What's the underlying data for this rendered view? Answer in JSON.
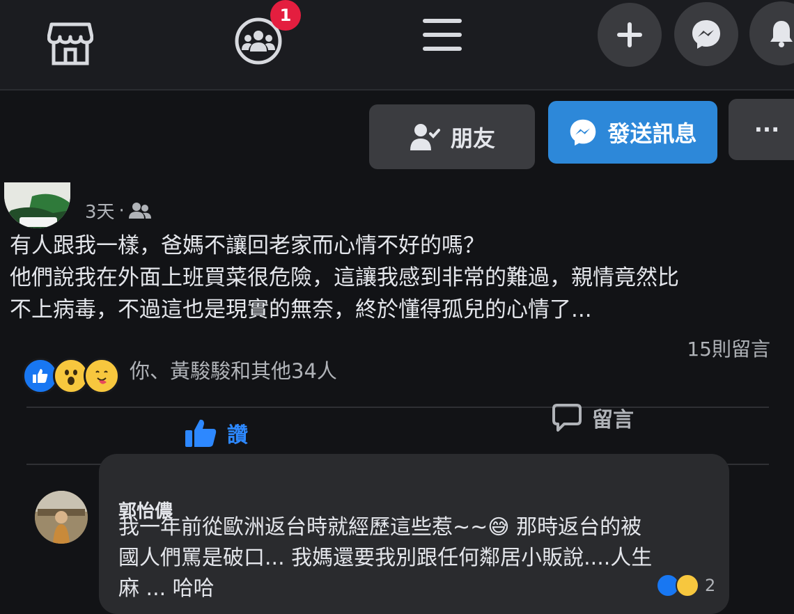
{
  "nav": {
    "notification_count": "1",
    "icons": [
      "marketplace-icon",
      "groups-icon",
      "menu-icon",
      "plus-icon",
      "messenger-icon",
      "bell-icon"
    ]
  },
  "profile_actions": {
    "friends_label": "朋友",
    "message_label": "發送訊息",
    "more_label": "···"
  },
  "post": {
    "time": "3天",
    "audience_separator": "·",
    "lines": [
      "有人跟我一樣，爸媽不讓回老家而心情不好的嗎？",
      "他們說我在外面上班買菜很危險，這讓我感到非常的難過，親情竟然比",
      "不上病毒，不過這也是現實的無奈，終於懂得孤兒的心情了..."
    ],
    "reactions_text": "你、黃駿駿和其他34人",
    "comments_count": "15則留言"
  },
  "actions": {
    "like_label": "讚",
    "comment_label": "留言"
  },
  "comment": {
    "author": "郭怡儂",
    "lines": [
      "我一年前從歐洲返台時就經歷這些惹~~😅 那時返台的被",
      "國人們罵是破口... 我媽還要我別跟任何鄰居小販說....人生",
      "麻 ... 哈哈"
    ],
    "reaction_count": "2"
  },
  "colors": {
    "background": "#121316",
    "accent": "#2d88d9",
    "like_blue": "#2d88ff",
    "badge_red": "#e41e3f"
  }
}
